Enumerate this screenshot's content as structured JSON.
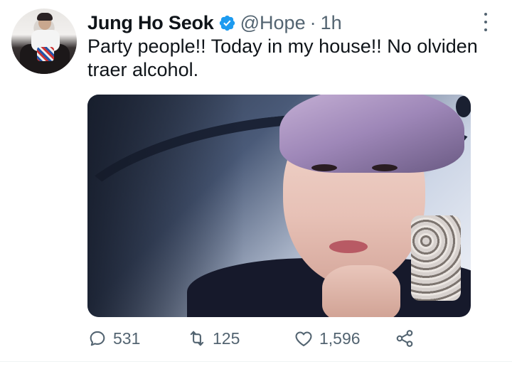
{
  "tweet": {
    "author_name": "Jung Ho Seok",
    "handle": "@Hope",
    "separator": "·",
    "time": "1h",
    "text": "Party people!! Today in my house!! No olviden traer alcohol.",
    "verified": true
  },
  "actions": {
    "reply_count": "531",
    "retweet_count": "125",
    "like_count": "1,596"
  },
  "icons": {
    "verified": "verified-badge-icon",
    "more": "more-vertical-icon",
    "reply": "reply-icon",
    "retweet": "retweet-icon",
    "like": "heart-icon",
    "share": "share-icon"
  },
  "colors": {
    "text": "#0f1419",
    "secondary": "#536471",
    "verified": "#1d9bf0"
  }
}
